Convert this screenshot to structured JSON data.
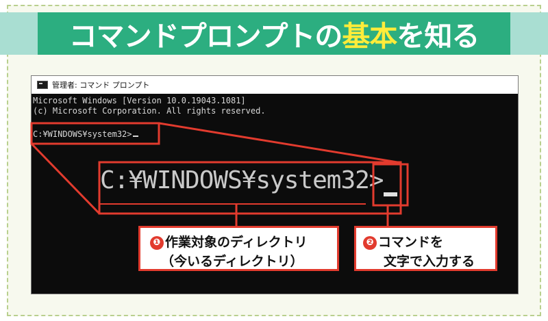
{
  "banner": {
    "title_pre": "コマンドプロンプトの",
    "title_highlight": "基本",
    "title_post": "を知る"
  },
  "window": {
    "title": "管理者: コマンド プロンプト",
    "console_line1": "Microsoft Windows [Version 10.0.19043.1081]",
    "console_line2": "(c) Microsoft Corporation. All rights reserved.",
    "prompt": "C:¥WINDOWS¥system32>"
  },
  "zoom": {
    "prompt": "C:¥WINDOWS¥system32>"
  },
  "callouts": [
    {
      "number": "❶",
      "line1": "作業対象のディレクトリ",
      "line2": "（今いるディレクトリ）"
    },
    {
      "number": "❷",
      "line1": "コマンドを",
      "line2": "文字で入力する"
    }
  ],
  "colors": {
    "banner_bg": "#2cae80",
    "title_highlight": "#ffec3a",
    "accent_red": "#e23b2e",
    "console_bg": "#0c0c0c"
  }
}
